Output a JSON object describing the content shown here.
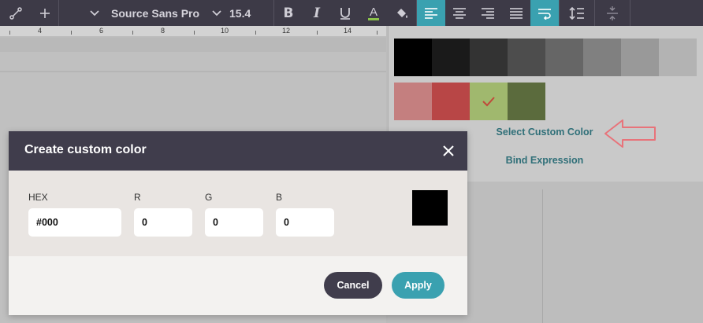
{
  "toolbar": {
    "font_name": "Source Sans Pro",
    "font_size": "15.4",
    "text_color_underline": "#8bc34a"
  },
  "ruler": {
    "numbers": [
      "4",
      "6",
      "8",
      "10",
      "12",
      "14"
    ]
  },
  "palette": {
    "row1": [
      "#000000",
      "#1a1a1a",
      "#333333",
      "#4d4d4d",
      "#666666",
      "#808080",
      "#999999",
      "#b3b3b3"
    ],
    "row2": [
      "#c47f7f",
      "#b84646",
      "#a0b86e",
      "#5b6b3d"
    ],
    "selected_index": 2,
    "select_custom_label": "Select Custom Color",
    "bind_expression_label": "Bind Expression"
  },
  "modal": {
    "title": "Create custom color",
    "hex_label": "HEX",
    "hex_value": "#000",
    "r_label": "R",
    "r_value": "0",
    "g_label": "G",
    "g_value": "0",
    "b_label": "B",
    "b_value": "0",
    "preview_color": "#000000",
    "cancel_label": "Cancel",
    "apply_label": "Apply"
  }
}
